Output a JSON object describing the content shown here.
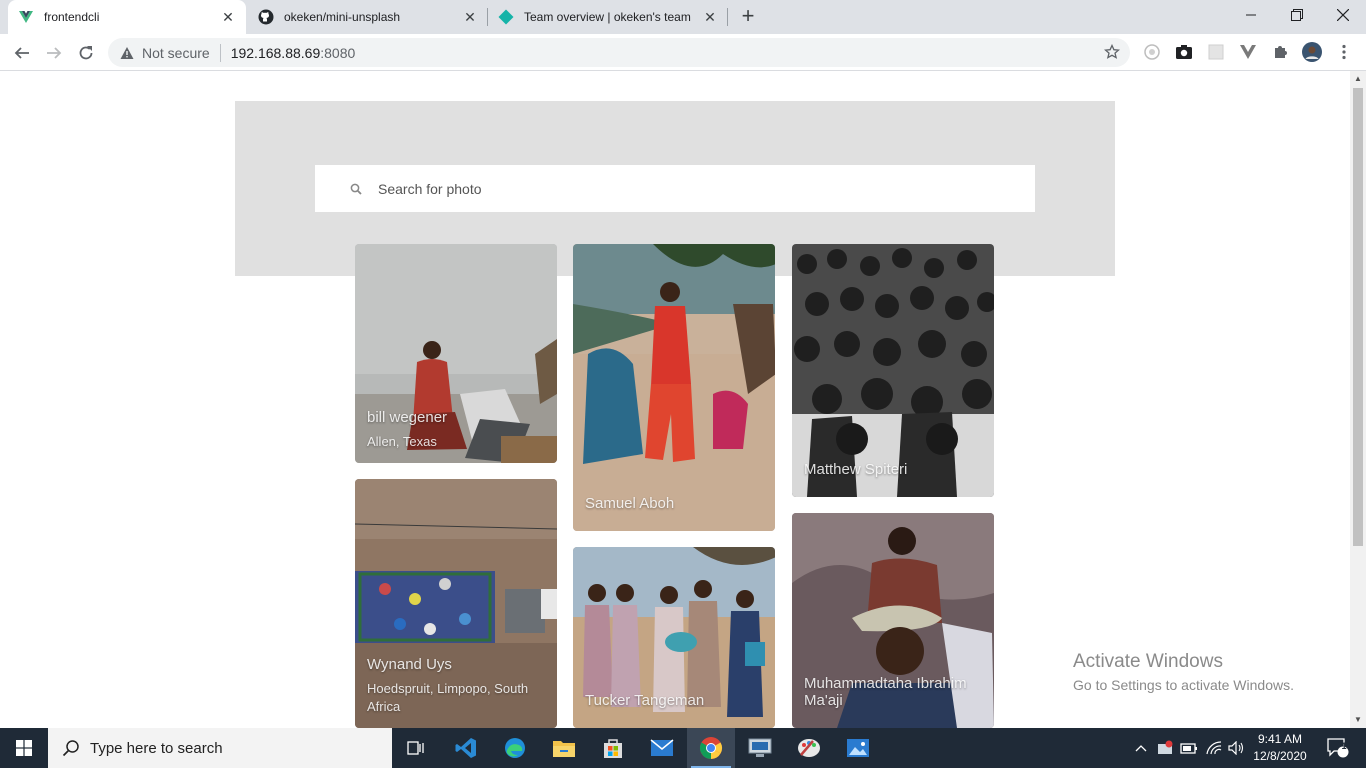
{
  "browser": {
    "tabs": [
      {
        "title": "frontendcli",
        "active": true,
        "icon": "vue-icon"
      },
      {
        "title": "okeken/mini-unsplash",
        "active": false,
        "icon": "github-icon"
      },
      {
        "title": "Team overview | okeken's team",
        "active": false,
        "icon": "netlify-icon"
      }
    ],
    "address": {
      "security_label": "Not secure",
      "host": "192.168.88.69",
      "port": ":8080"
    }
  },
  "page": {
    "search": {
      "placeholder": "Search for photo",
      "value": ""
    },
    "photos": [
      {
        "name": "bill wegener",
        "location": "Allen, Texas"
      },
      {
        "name": "Samuel Aboh",
        "location": ""
      },
      {
        "name": "Matthew Spiteri",
        "location": ""
      },
      {
        "name": "Wynand Uys",
        "location": "Hoedspruit, Limpopo, South Africa"
      },
      {
        "name": "Tucker Tangeman",
        "location": ""
      },
      {
        "name": "Muhammadtaha Ibrahim Ma'aji",
        "location": ""
      }
    ]
  },
  "watermark": {
    "line1": "Activate Windows",
    "line2": "Go to Settings to activate Windows."
  },
  "taskbar": {
    "search_placeholder": "Type here to search",
    "time": "9:41 AM",
    "date": "12/8/2020",
    "notification_count": "1"
  },
  "colors": {
    "hero_bg": "#e0e0e0",
    "taskbar_bg": "#1f2a37",
    "tabstrip_bg": "#dee1e6"
  }
}
